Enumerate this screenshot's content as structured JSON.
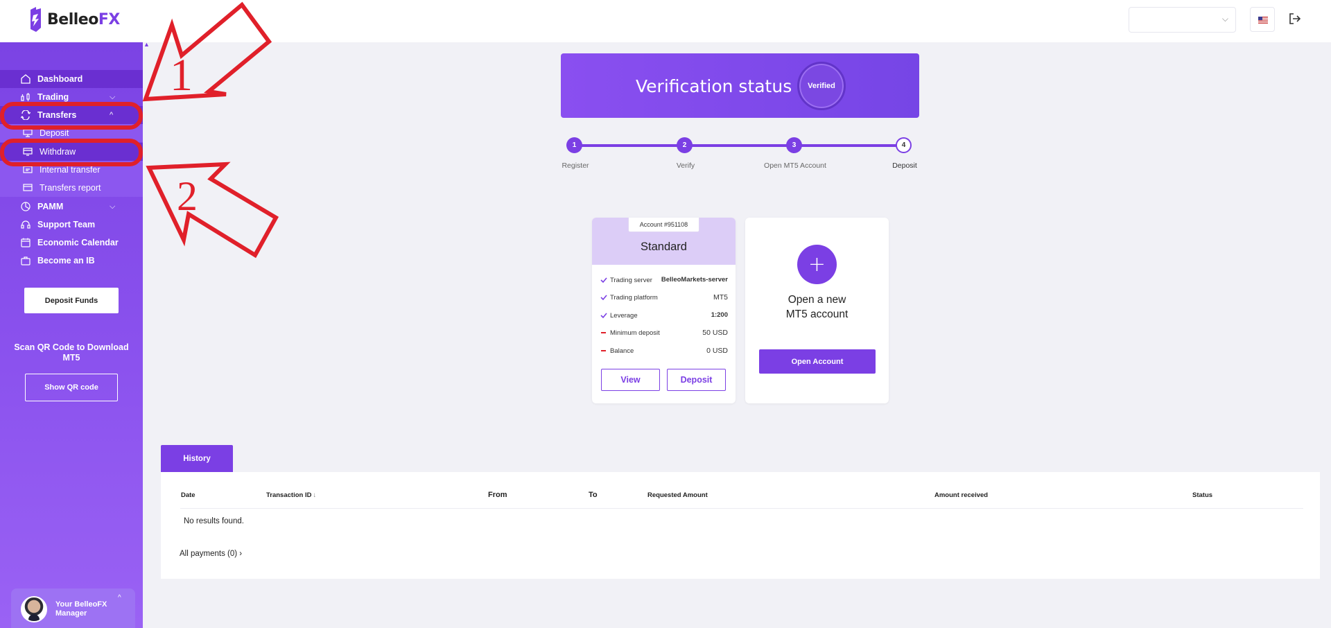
{
  "header": {
    "logo_main": "Belleo",
    "logo_accent": "FX"
  },
  "sidebar": {
    "items": [
      {
        "label": "Dashboard"
      },
      {
        "label": "Trading"
      },
      {
        "label": "Transfers"
      },
      {
        "label": "Deposit"
      },
      {
        "label": "Withdraw"
      },
      {
        "label": "Internal transfer"
      },
      {
        "label": "Transfers report"
      },
      {
        "label": "PAMM"
      },
      {
        "label": "Support Team"
      },
      {
        "label": "Economic Calendar"
      },
      {
        "label": "Become an IB"
      }
    ],
    "deposit_funds": "Deposit Funds",
    "qr_text": "Scan QR Code to Download MT5",
    "show_qr": "Show QR code",
    "manager_text": "Your BelleoFX Manager"
  },
  "annotations": {
    "arrow1": "1",
    "arrow2": "2",
    "color": "#e0202a"
  },
  "verification": {
    "title": "Verification status",
    "badge": "Verified"
  },
  "steps": [
    {
      "num": "1",
      "label": "Register"
    },
    {
      "num": "2",
      "label": "Verify"
    },
    {
      "num": "3",
      "label": "Open MT5 Account"
    },
    {
      "num": "4",
      "label": "Deposit"
    }
  ],
  "account": {
    "tag": "Account #951108",
    "type": "Standard",
    "rows": [
      {
        "key": "Trading server",
        "value": "BelleoMarkets-server"
      },
      {
        "key": "Trading platform",
        "value": "MT5"
      },
      {
        "key": "Leverage",
        "value": "1:200"
      },
      {
        "key": "Minimum deposit",
        "value": "50 USD"
      },
      {
        "key": "Balance",
        "value": "0 USD"
      }
    ],
    "view_label": "View",
    "deposit_label": "Deposit"
  },
  "new_account": {
    "title_line1": "Open a new",
    "title_line2": "MT5 account",
    "button": "Open Account"
  },
  "history": {
    "tab": "History",
    "columns": [
      "Date",
      "Transaction ID",
      "From",
      "To",
      "Requested Amount",
      "Amount received",
      "Status"
    ],
    "sort_mark": "↓",
    "empty": "No results found.",
    "all_payments": "All payments (0)",
    "all_payments_chev": "›"
  },
  "colors": {
    "accent": "#7b3fe4",
    "sidebar_active": "#6a2fd1"
  }
}
